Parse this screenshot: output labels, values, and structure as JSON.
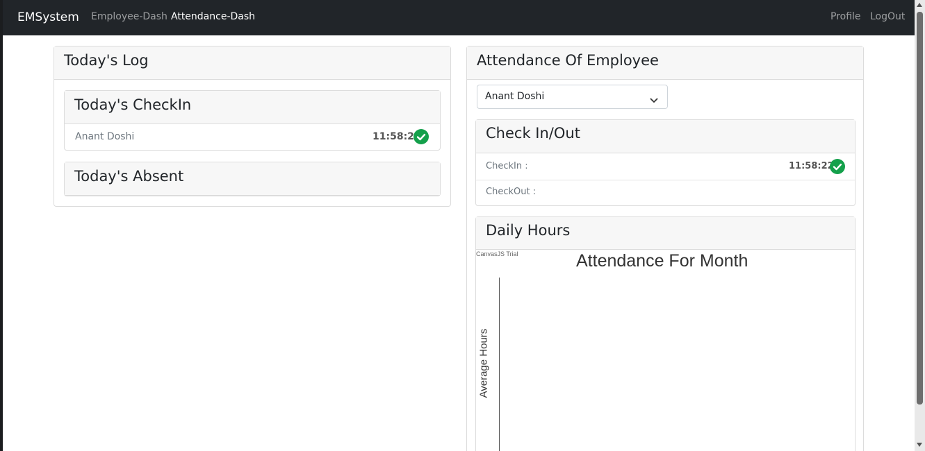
{
  "navbar": {
    "brand": "EMSystem",
    "links": [
      "Employee-Dash",
      "Attendance-Dash"
    ],
    "right_links": [
      "Profile",
      "LogOut"
    ]
  },
  "todays_log": {
    "title": "Today's Log",
    "checkin": {
      "title": "Today's CheckIn",
      "entries": [
        {
          "name": "Anant Doshi",
          "time": "11:58:22"
        }
      ]
    },
    "absent": {
      "title": "Today's Absent"
    }
  },
  "attendance": {
    "title": "Attendance Of Employee",
    "selected_employee": "Anant Doshi",
    "check_in_out": {
      "title": "Check In/Out",
      "checkin_label": "CheckIn :",
      "checkin_time": "11:58:22",
      "checkout_label": "CheckOut :"
    },
    "daily_hours": {
      "title": "Daily Hours"
    }
  },
  "chart_data": {
    "type": "bar",
    "title": "Attendance For Month",
    "ylabel": "Average Hours",
    "xlabel": "",
    "watermark": "CanvasJS Trial",
    "categories": [],
    "values": []
  },
  "colors": {
    "navbar": "#212529",
    "success": "#14a04b",
    "card_header": "#f7f7f7"
  }
}
